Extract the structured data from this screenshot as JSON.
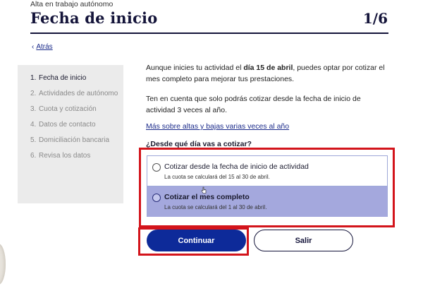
{
  "header": {
    "kicker": "Alta en trabajo autónomo",
    "title": "Fecha de inicio",
    "step": "1/6"
  },
  "back_link": {
    "label": "Atrás",
    "icon": "chevron-left-icon"
  },
  "sidebar": {
    "items": [
      {
        "num": "1.",
        "label": "Fecha de inicio",
        "active": true
      },
      {
        "num": "2.",
        "label": "Actividades de autónomo",
        "active": false
      },
      {
        "num": "3.",
        "label": "Cuota y cotización",
        "active": false
      },
      {
        "num": "4.",
        "label": "Datos de contacto",
        "active": false
      },
      {
        "num": "5.",
        "label": "Domiciliación bancaria",
        "active": false
      },
      {
        "num": "6.",
        "label": "Revisa los datos",
        "active": false
      }
    ]
  },
  "main": {
    "intro_before": "Aunque inicies tu actividad el ",
    "intro_bold": "día 15 de abril",
    "intro_after": ", puedes optar por cotizar el mes completo para mejorar tus prestaciones.",
    "note": "Ten en cuenta que solo podrás cotizar desde la fecha de inicio de actividad 3 veces al año.",
    "more_link": "Más sobre altas y bajas varias veces al año",
    "question": "¿Desde qué día vas a cotizar?",
    "options": [
      {
        "title": "Cotizar desde la fecha de inicio de actividad",
        "subtitle": "La cuota se calculará del 15 al 30 de abril.",
        "highlighted": false
      },
      {
        "title": "Cotizar el mes completo",
        "subtitle": "La cuota se calculará del 1 al 30 de abril.",
        "highlighted": true
      }
    ]
  },
  "actions": {
    "continue_label": "Continuar",
    "exit_label": "Salir"
  },
  "colors": {
    "primary": "#0d2a99",
    "highlight_option": "#a4a8dd",
    "annotation_red": "#d3141b",
    "sidebar_bg": "#ebebeb"
  }
}
